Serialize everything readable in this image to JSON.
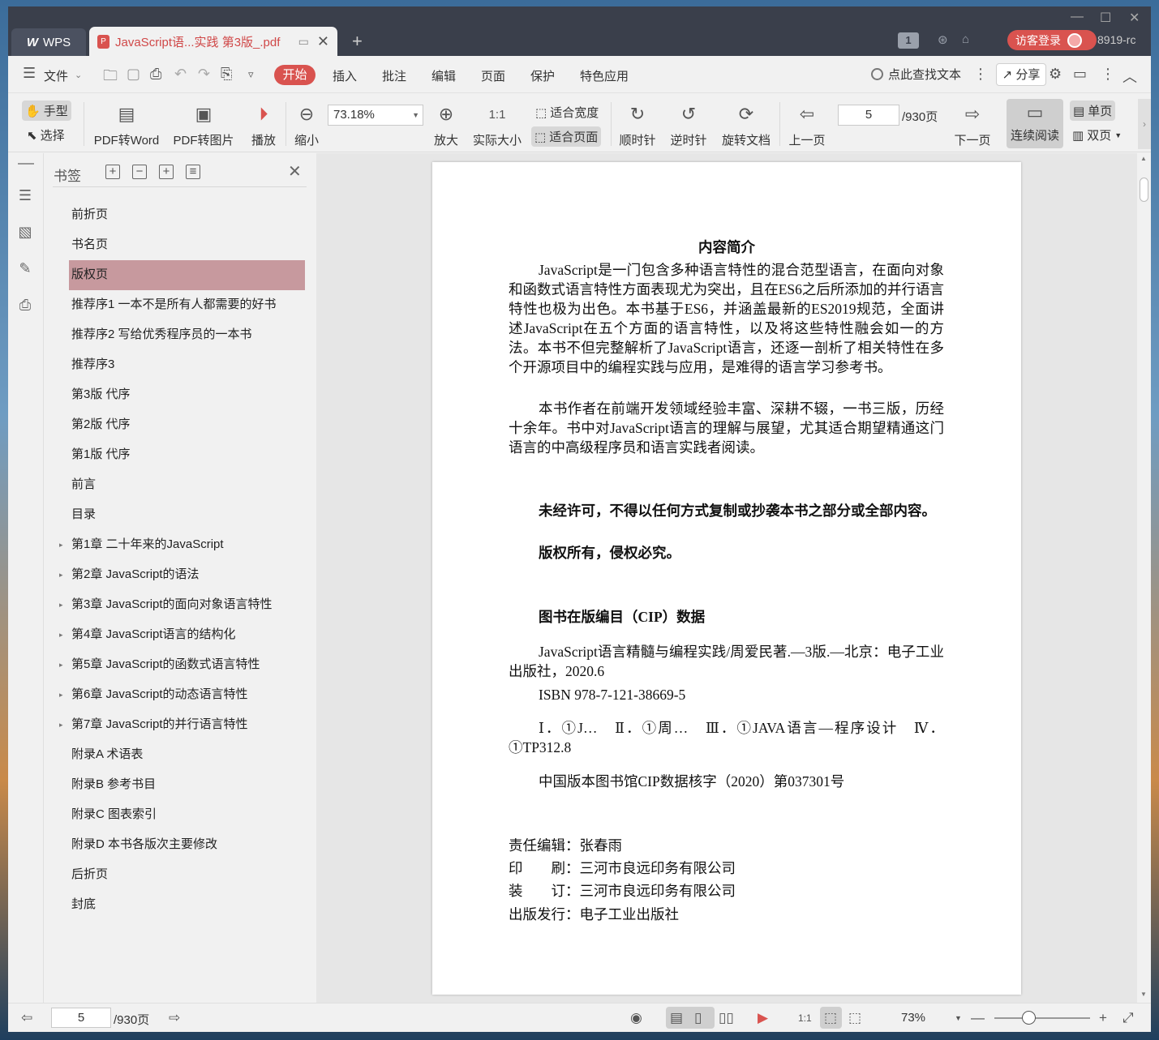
{
  "titlebar": {
    "wps_label": "WPS",
    "doc_tab_title": "JavaScript语...实践 第3版_.pdf",
    "page_badge": "1",
    "login_label": "访客登录",
    "user_id": "8919-rc"
  },
  "menu": {
    "file": "文件",
    "start": "开始",
    "insert": "插入",
    "annotate": "批注",
    "edit": "编辑",
    "page": "页面",
    "protect": "保护",
    "special": "特色应用",
    "search_placeholder": "点此查找文本",
    "share": "分享"
  },
  "toolbar": {
    "hand": "手型",
    "select": "选择",
    "pdf_to_word": "PDF转Word",
    "pdf_to_image": "PDF转图片",
    "play": "播放",
    "zoom_out": "缩小",
    "zoom_value": "73.18%",
    "fit_width": "适合宽度",
    "fit_page": "适合页面",
    "zoom_in": "放大",
    "actual_size": "实际大小",
    "clockwise": "顺时针",
    "counter_clockwise": "逆时针",
    "rotate_doc": "旋转文档",
    "prev_page": "上一页",
    "page_value": "5",
    "page_total": "/930页",
    "next_page": "下一页",
    "continuous": "连续阅读",
    "single": "单页",
    "double": "双页"
  },
  "bookmarks": {
    "title": "书签",
    "items": [
      {
        "label": "前折页",
        "expandable": false,
        "selected": false
      },
      {
        "label": "书名页",
        "expandable": false,
        "selected": false
      },
      {
        "label": "版权页",
        "expandable": false,
        "selected": true
      },
      {
        "label": "推荐序1 一本不是所有人都需要的好书",
        "expandable": false,
        "selected": false
      },
      {
        "label": "推荐序2 写给优秀程序员的一本书",
        "expandable": false,
        "selected": false
      },
      {
        "label": "推荐序3",
        "expandable": false,
        "selected": false
      },
      {
        "label": "第3版 代序",
        "expandable": false,
        "selected": false
      },
      {
        "label": "第2版 代序",
        "expandable": false,
        "selected": false
      },
      {
        "label": "第1版 代序",
        "expandable": false,
        "selected": false
      },
      {
        "label": "前言",
        "expandable": false,
        "selected": false
      },
      {
        "label": "目录",
        "expandable": false,
        "selected": false
      },
      {
        "label": "第1章 二十年来的JavaScript",
        "expandable": true,
        "selected": false
      },
      {
        "label": "第2章 JavaScript的语法",
        "expandable": true,
        "selected": false
      },
      {
        "label": "第3章 JavaScript的面向对象语言特性",
        "expandable": true,
        "selected": false
      },
      {
        "label": "第4章 JavaScript语言的结构化",
        "expandable": true,
        "selected": false
      },
      {
        "label": "第5章 JavaScript的函数式语言特性",
        "expandable": true,
        "selected": false
      },
      {
        "label": "第6章 JavaScript的动态语言特性",
        "expandable": true,
        "selected": false
      },
      {
        "label": "第7章 JavaScript的并行语言特性",
        "expandable": true,
        "selected": false
      },
      {
        "label": "附录A 术语表",
        "expandable": false,
        "selected": false
      },
      {
        "label": "附录B 参考书目",
        "expandable": false,
        "selected": false
      },
      {
        "label": "附录C 图表索引",
        "expandable": false,
        "selected": false
      },
      {
        "label": "附录D 本书各版次主要修改",
        "expandable": false,
        "selected": false
      },
      {
        "label": "后折页",
        "expandable": false,
        "selected": false
      },
      {
        "label": "封底",
        "expandable": false,
        "selected": false
      }
    ]
  },
  "document": {
    "heading": "内容简介",
    "para1": "JavaScript是一门包含多种语言特性的混合范型语言，在面向对象和函数式语言特性方面表现尤为突出，且在ES6之后所添加的并行语言特性也极为出色。本书基于ES6，并涵盖最新的ES2019规范，全面讲述JavaScript在五个方面的语言特性，以及将这些特性融会如一的方法。本书不但完整解析了JavaScript语言，还逐一剖析了相关特性在多个开源项目中的编程实践与应用，是难得的语言学习参考书。",
    "para2": "本书作者在前端开发领域经验丰富、深耕不辍，一书三版，历经十余年。书中对JavaScript语言的理解与展望，尤其适合期望精通这门语言的中高级程序员和语言实践者阅读。",
    "notice1": "未经许可，不得以任何方式复制或抄袭本书之部分或全部内容。",
    "notice2": "版权所有，侵权必究。",
    "cip_title": "图书在版编目（CIP）数据",
    "cip1": "JavaScript语言精髓与编程实践/周爱民著.—3版.—北京：电子工业出版社，2020.6",
    "cip2": "ISBN 978-7-121-38669-5",
    "cip3": "Ⅰ．①J…　Ⅱ．①周…　Ⅲ．①JAVA语言—程序设计　Ⅳ．①TP312.8",
    "cip4": "中国版本图书馆CIP数据核字（2020）第037301号",
    "editor": "责任编辑：张春雨",
    "print": "印　　刷：三河市良远印务有限公司",
    "bind": "装　　订：三河市良远印务有限公司",
    "publisher": "出版发行：电子工业出版社"
  },
  "statusbar": {
    "page_value": "5",
    "page_total": "/930页",
    "zoom": "73%"
  }
}
